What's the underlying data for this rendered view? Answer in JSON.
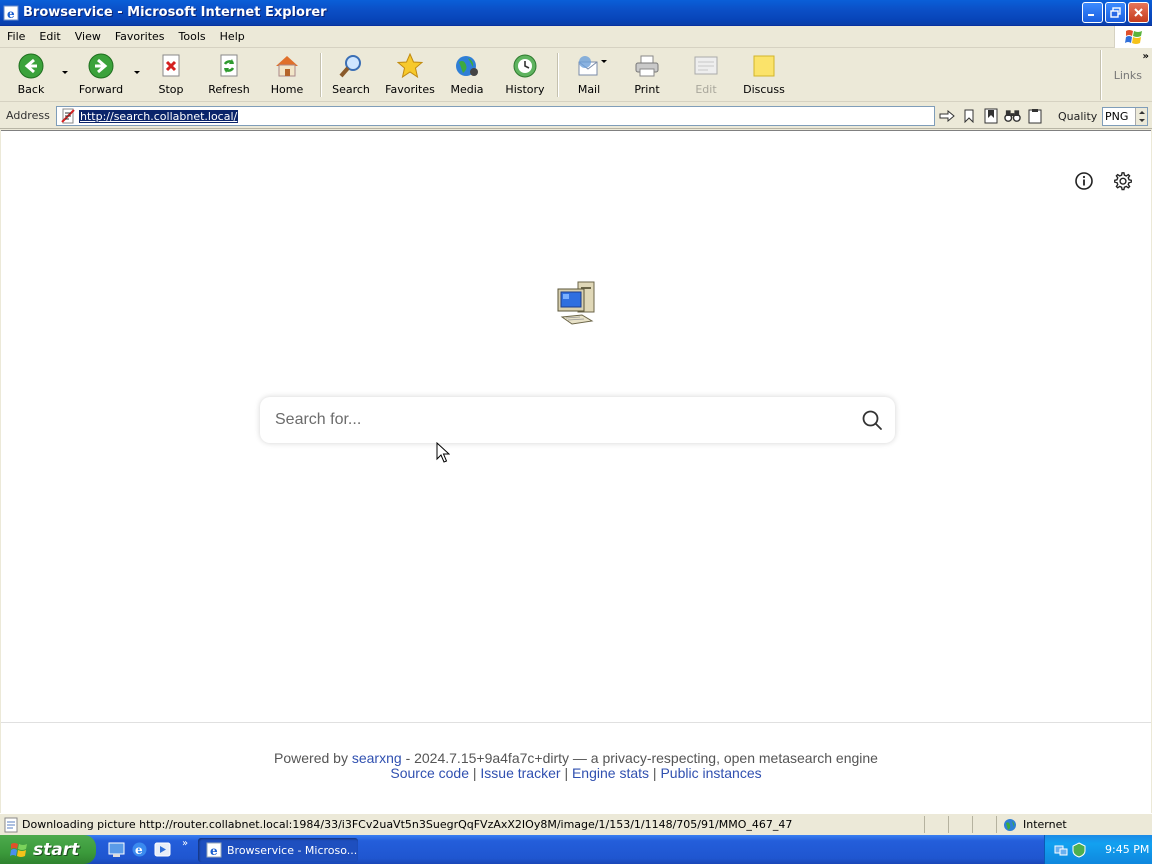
{
  "window": {
    "title": "Browservice - Microsoft Internet Explorer"
  },
  "menubar": {
    "items": [
      "File",
      "Edit",
      "View",
      "Favorites",
      "Tools",
      "Help"
    ]
  },
  "toolbar": {
    "back": "Back",
    "forward": "Forward",
    "stop": "Stop",
    "refresh": "Refresh",
    "home": "Home",
    "search": "Search",
    "favorites": "Favorites",
    "media": "Media",
    "history": "History",
    "mail": "Mail",
    "print": "Print",
    "edit": "Edit",
    "discuss": "Discuss",
    "links": "Links"
  },
  "addressbar": {
    "label": "Address",
    "url": "http://search.collabnet.local/",
    "quality_label": "Quality",
    "quality_value": "PNG"
  },
  "page": {
    "search_placeholder": "Search for...",
    "footer": {
      "powered_by": "Powered by",
      "searxng": "searxng",
      "version_text": "- 2024.7.15+9a4fa7c+dirty — a privacy-respecting, open metasearch engine",
      "source_code": "Source code",
      "issue_tracker": "Issue tracker",
      "engine_stats": "Engine stats",
      "public_instances": "Public instances",
      "sep": "|"
    }
  },
  "statusbar": {
    "text": "Downloading picture http://router.collabnet.local:1984/33/i3FCv2uaVt5n3SuegrQqFVzAxX2IOy8M/image/1/153/1/1148/705/91/MMO_467_47",
    "zone": "Internet"
  },
  "taskbar": {
    "start": "start",
    "task_item": "Browservice - Microso...",
    "clock": "9:45 PM"
  },
  "colors": {
    "titlebar": "#0A5FD8",
    "link": "#3050B0",
    "selection": "#0A246A",
    "start": "#3B9A3B"
  }
}
